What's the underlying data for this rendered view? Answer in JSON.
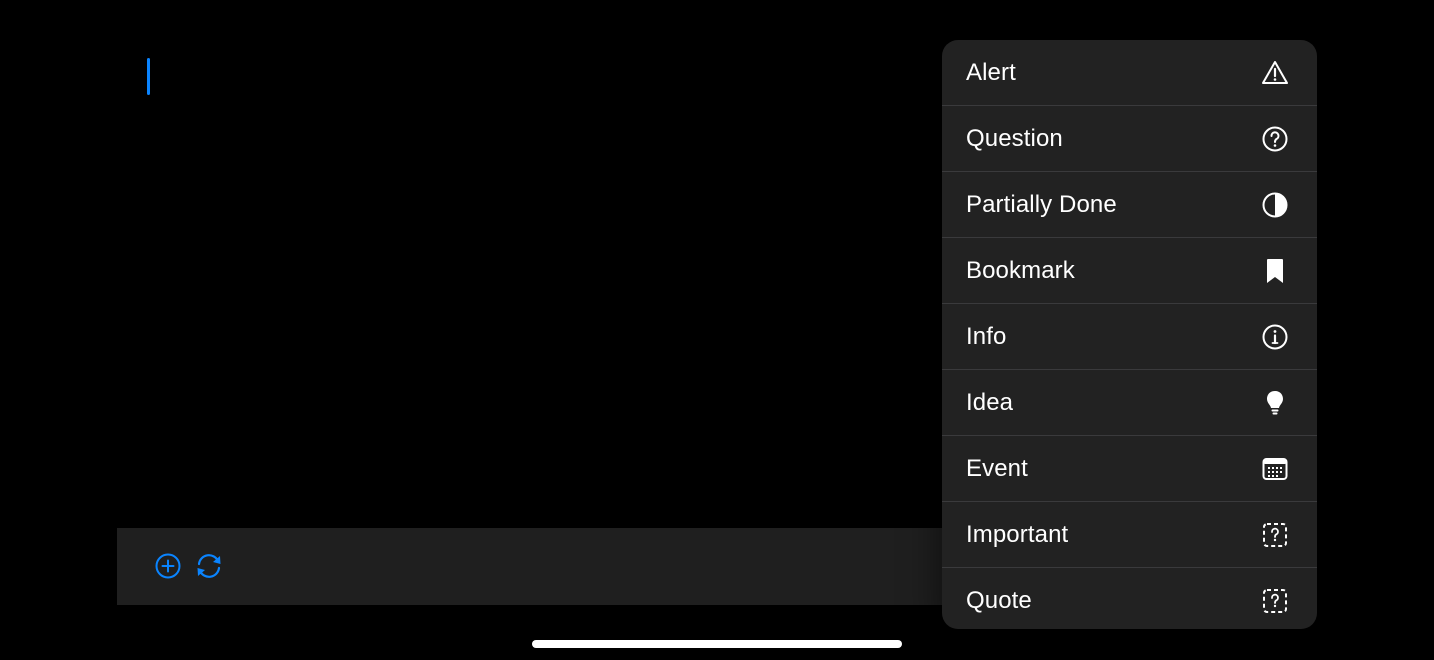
{
  "colors": {
    "accent": "#0a84ff",
    "background": "#000000",
    "toolbar_bg": "#1f1f1f",
    "menu_bg": "#222222",
    "menu_divider": "#3a3a3c",
    "menu_text": "#ffffff"
  },
  "toolbar": {
    "buttons": [
      {
        "icon": "plus-circle-icon"
      },
      {
        "icon": "sync-icon"
      }
    ]
  },
  "menu": {
    "items": [
      {
        "label": "Alert",
        "icon": "warning-triangle-icon"
      },
      {
        "label": "Question",
        "icon": "question-circle-icon"
      },
      {
        "label": "Partially Done",
        "icon": "half-circle-icon"
      },
      {
        "label": "Bookmark",
        "icon": "bookmark-icon"
      },
      {
        "label": "Info",
        "icon": "info-circle-icon"
      },
      {
        "label": "Idea",
        "icon": "lightbulb-icon"
      },
      {
        "label": "Event",
        "icon": "calendar-icon"
      },
      {
        "label": "Important",
        "icon": "dashed-question-square-icon"
      },
      {
        "label": "Quote",
        "icon": "dashed-question-square-icon"
      }
    ]
  }
}
